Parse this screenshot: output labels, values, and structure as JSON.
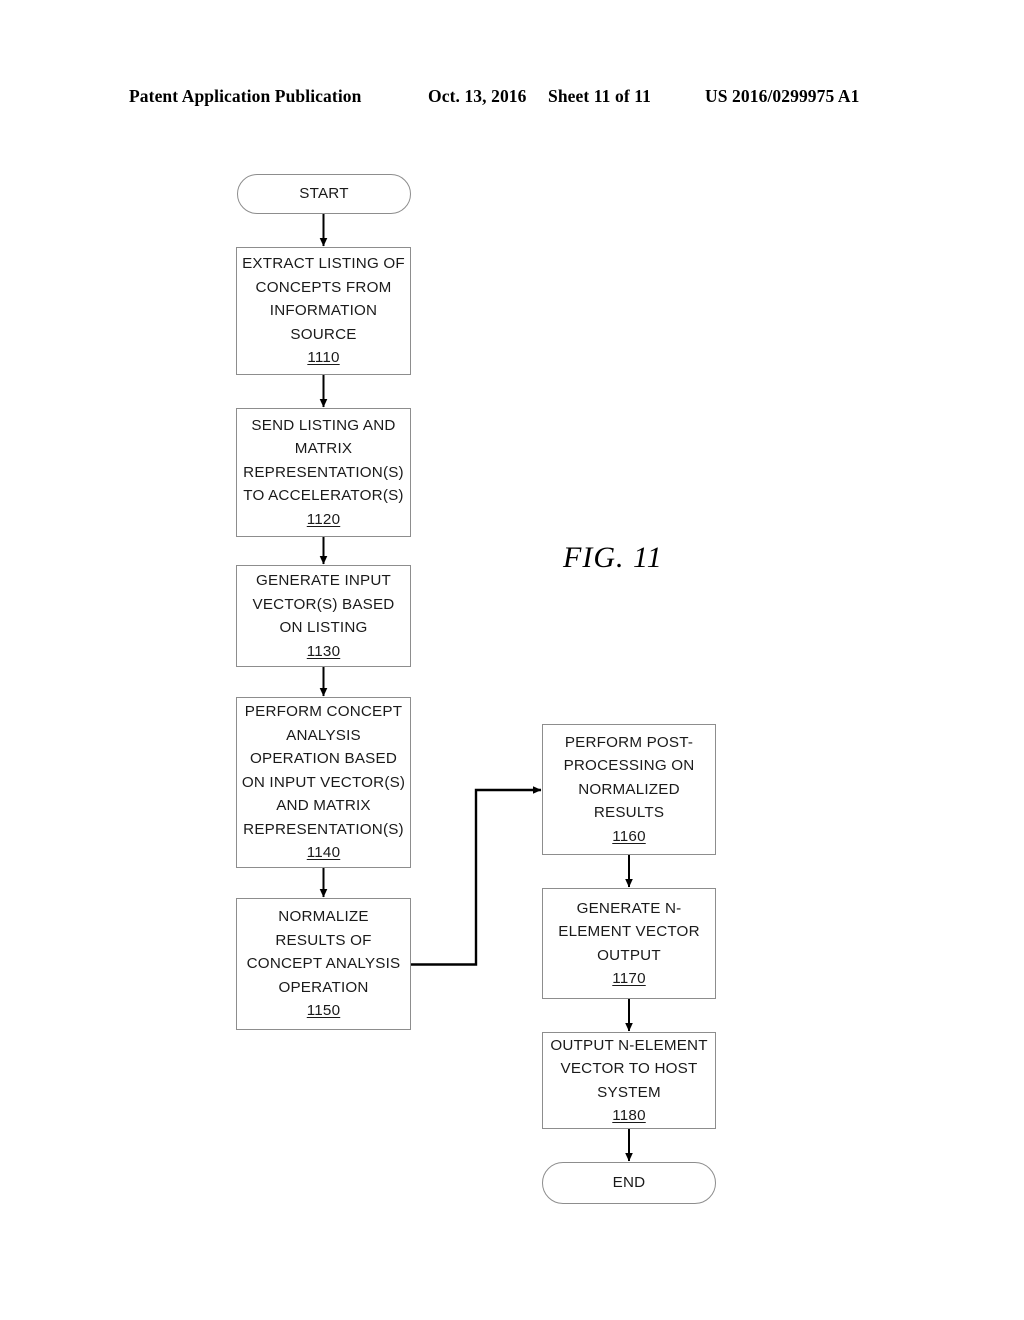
{
  "header": {
    "publication": "Patent Application Publication",
    "date": "Oct. 13, 2016",
    "sheet": "Sheet 11 of 11",
    "document_number": "US 2016/0299975 A1"
  },
  "figure": {
    "label": "FIG. 11"
  },
  "flowchart": {
    "nodes": [
      {
        "id": "start",
        "shape": "terminal",
        "text": "START",
        "ref": ""
      },
      {
        "id": "step-1110",
        "shape": "process",
        "text": "EXTRACT LISTING OF\nCONCEPTS FROM\nINFORMATION\nSOURCE",
        "ref": "1110"
      },
      {
        "id": "step-1120",
        "shape": "process",
        "text": "SEND LISTING AND\nMATRIX\nREPRESENTATION(S)\nTO ACCELERATOR(S)",
        "ref": "1120"
      },
      {
        "id": "step-1130",
        "shape": "process",
        "text": "GENERATE INPUT\nVECTOR(S) BASED\nON LISTING",
        "ref": "1130"
      },
      {
        "id": "step-1140",
        "shape": "process",
        "text": "PERFORM CONCEPT\nANALYSIS\nOPERATION BASED\nON INPUT VECTOR(S)\nAND MATRIX\nREPRESENTATION(S)",
        "ref": "1140"
      },
      {
        "id": "step-1150",
        "shape": "process",
        "text": "NORMALIZE\nRESULTS OF\nCONCEPT ANALYSIS\nOPERATION",
        "ref": "1150"
      },
      {
        "id": "step-1160",
        "shape": "process",
        "text": "PERFORM POST-\nPROCESSING ON\nNORMALIZED\nRESULTS",
        "ref": "1160"
      },
      {
        "id": "step-1170",
        "shape": "process",
        "text": "GENERATE N-\nELEMENT VECTOR\nOUTPUT",
        "ref": "1170"
      },
      {
        "id": "step-1180",
        "shape": "process",
        "text": "OUTPUT N-ELEMENT\nVECTOR TO HOST\nSYSTEM",
        "ref": "1180"
      },
      {
        "id": "end",
        "shape": "terminal",
        "text": "END",
        "ref": ""
      }
    ],
    "flow_order": [
      "start",
      "step-1110",
      "step-1120",
      "step-1130",
      "step-1140",
      "step-1150",
      "step-1160",
      "step-1170",
      "step-1180",
      "end"
    ],
    "colors": {
      "node_border": "#8d8d8d",
      "connector": "#000000",
      "text": "#1a1a1a",
      "background": "#ffffff"
    }
  }
}
